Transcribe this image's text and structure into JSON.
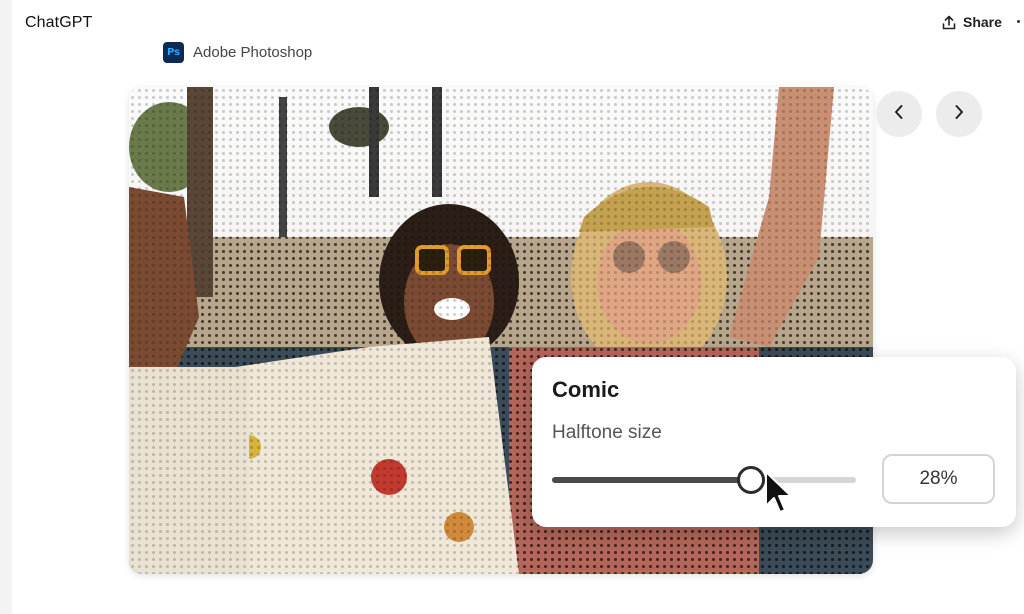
{
  "header": {
    "app_title": "ChatGPT",
    "share_label": "Share"
  },
  "connector": {
    "logo_text": "Ps",
    "name": "Adobe Photoshop"
  },
  "image_nav": {
    "prev_icon": "chevron-left-icon",
    "next_icon": "chevron-right-icon"
  },
  "effect_panel": {
    "title": "Comic",
    "control_label": "Halftone size",
    "value": 28,
    "value_text": "28%"
  },
  "colors": {
    "ps_logo_bg": "#0b2a55",
    "ps_logo_text": "#31a8ff",
    "slider_fill": "#4a4a4a"
  }
}
